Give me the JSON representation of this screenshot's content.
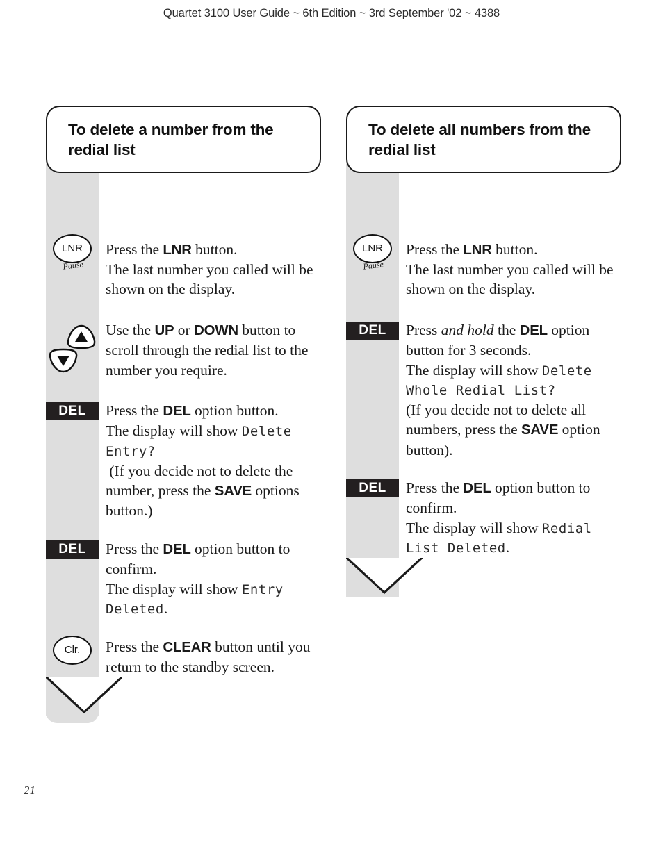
{
  "header": {
    "running_head": "Quartet 3100 User Guide ~ 6th Edition ~ 3rd September '02 ~ 4388"
  },
  "page": {
    "number": "21"
  },
  "keys": {
    "lnr_label": "LNR",
    "lnr_sublabel": "Pause",
    "del_label": "DEL",
    "clear_label": "Clr.",
    "up_icon": "up-triangle",
    "down_icon": "down-triangle"
  },
  "columns": [
    {
      "id": "delete-one",
      "callout": "To delete a number from the redial list",
      "steps": [
        {
          "icon": "lnr-key",
          "paragraphs": [
            {
              "id": "p1",
              "html": "Press the <b>LNR</b> button."
            },
            {
              "id": "p2",
              "html": "The last number you called will be shown on the display."
            }
          ]
        },
        {
          "icon": "updown-keys",
          "paragraphs": [
            {
              "id": "p3",
              "html": "Use the <b>UP</b> or <b>DOWN</b> button to scroll through the redial list to the number you require."
            }
          ]
        },
        {
          "icon": "del-key",
          "paragraphs": [
            {
              "id": "p4",
              "html": "Press the <b>DEL</b> option button."
            },
            {
              "id": "p5",
              "html": "The display will show <span class=\"lcd\">Delete Entry?</span>"
            },
            {
              "id": "p6",
              "html": "&nbsp;(If you decide not to delete the number, press the <b>SAVE</b> options button.)"
            }
          ]
        },
        {
          "icon": "del-key",
          "paragraphs": [
            {
              "id": "p7",
              "html": "Press the <b>DEL</b> option button to confirm."
            },
            {
              "id": "p8",
              "html": "The display will show <span class=\"lcd\">Entry Deleted</span>."
            }
          ]
        },
        {
          "icon": "clear-key",
          "paragraphs": [
            {
              "id": "p9",
              "html": "Press the <b>CLEAR</b> button until you return to the standby screen."
            }
          ]
        }
      ]
    },
    {
      "id": "delete-all",
      "callout": "To delete all numbers from the redial list",
      "steps": [
        {
          "icon": "lnr-key",
          "paragraphs": [
            {
              "id": "q1",
              "html": "Press the <b>LNR</b> button."
            },
            {
              "id": "q2",
              "html": "The last number you called will be shown on the display."
            }
          ]
        },
        {
          "icon": "del-key",
          "paragraphs": [
            {
              "id": "q3",
              "html": "Press <i>and hold</i> the <b>DEL</b> option button for 3 seconds."
            },
            {
              "id": "q4",
              "html": "The display will show <span class=\"lcd\">Delete Whole Redial List?</span>"
            },
            {
              "id": "q5",
              "html": "(If you decide not to delete all numbers, press the <b>SAVE</b> option button)."
            }
          ]
        },
        {
          "icon": "del-key",
          "paragraphs": [
            {
              "id": "q6",
              "html": "Press the <b>DEL</b> option button to confirm."
            },
            {
              "id": "q7",
              "html": "The display will show <span class=\"lcd\">Redial List Deleted</span>."
            }
          ]
        }
      ]
    }
  ],
  "colors": {
    "rail_grey": "#dedede",
    "key_black": "#231f20",
    "ink": "#1a1a1a",
    "paper": "#ffffff"
  }
}
